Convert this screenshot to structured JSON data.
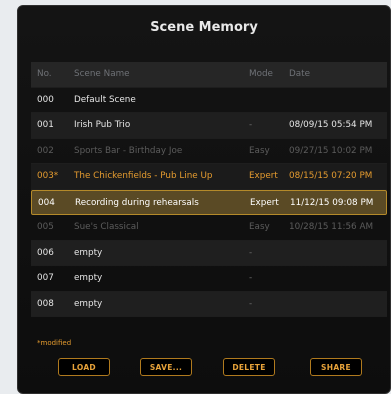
{
  "title": "Scene Memory",
  "columns": {
    "no": "No.",
    "name": "Scene Name",
    "mode": "Mode",
    "date": "Date"
  },
  "rows": [
    {
      "no": "000",
      "name": "Default Scene",
      "mode": "",
      "date": ""
    },
    {
      "no": "001",
      "name": "Irish Pub Trio",
      "mode": "-",
      "date": "08/09/15  05:54 PM"
    },
    {
      "no": "002",
      "name": "Sports Bar - Birthday Joe",
      "mode": "Easy",
      "date": "09/27/15  10:02 PM"
    },
    {
      "no": "003*",
      "name": "The Chickenfields - Pub Line Up",
      "mode": "Expert",
      "date": "08/15/15  07:20 PM"
    },
    {
      "no": "004",
      "name": "Recording during rehearsals",
      "mode": "Expert",
      "date": "11/12/15   09:08 PM"
    },
    {
      "no": "005",
      "name": "Sue's Classical",
      "mode": "Easy",
      "date": "10/28/15  11:56 AM"
    },
    {
      "no": "006",
      "name": "empty",
      "mode": "-",
      "date": ""
    },
    {
      "no": "007",
      "name": "empty",
      "mode": "-",
      "date": ""
    },
    {
      "no": "008",
      "name": "empty",
      "mode": "-",
      "date": ""
    }
  ],
  "modified_note": "*modified",
  "buttons": {
    "load": "LOAD",
    "save": "SAVE...",
    "delete": "DELETE",
    "share": "SHARE"
  },
  "colors": {
    "accent": "#e49b2f",
    "selected_bg": "#5a4a25",
    "selected_border": "#b48a2a"
  }
}
